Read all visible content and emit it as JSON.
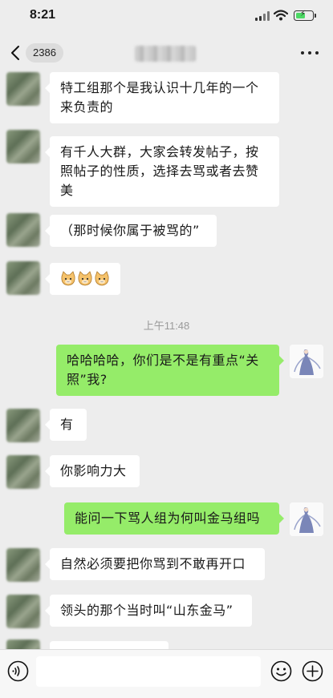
{
  "status_bar": {
    "time": "8:21"
  },
  "nav": {
    "back_count": "2386"
  },
  "messages": [
    {
      "side": "in",
      "text": "特工组那个是我认识十几年的一个来负责的"
    },
    {
      "side": "in",
      "text": "有千人大群，大家会转发帖子，按照帖子的性质，选择去骂或者去赞美"
    },
    {
      "side": "in",
      "text": "（那时候你属于被骂的”"
    },
    {
      "side": "in",
      "emojis": [
        "cat-face-icon",
        "cat-face-icon",
        "cat-face-icon"
      ]
    },
    {
      "timestamp": "上午11:48"
    },
    {
      "side": "out",
      "text": "哈哈哈哈，你们是不是有重点“关照”我?"
    },
    {
      "side": "in",
      "text": "有"
    },
    {
      "side": "in",
      "text": "你影响力大"
    },
    {
      "side": "out",
      "text": "能问一下骂人组为何叫金马组吗"
    },
    {
      "side": "in",
      "text": "自然必须要把你骂到不敢再开口"
    },
    {
      "side": "in",
      "text": "领头的那个当时叫“山东金马”"
    }
  ],
  "input_bar": {
    "placeholder": ""
  },
  "colors": {
    "outgoing_bubble": "#95ec69",
    "incoming_bubble": "#ffffff",
    "background": "#ededed"
  }
}
